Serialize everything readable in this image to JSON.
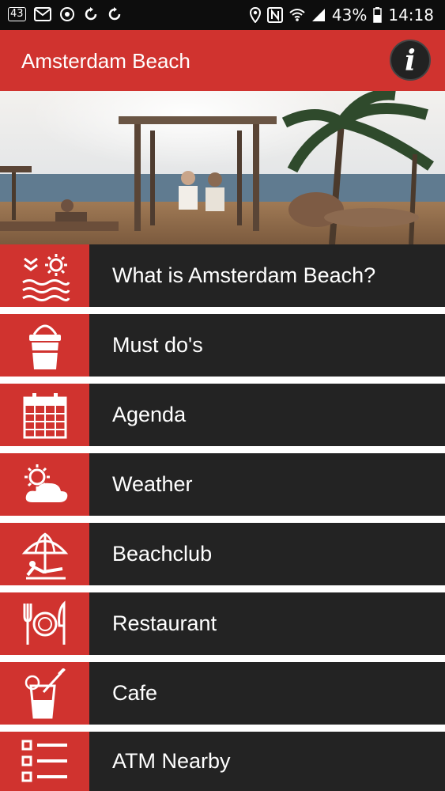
{
  "status_bar": {
    "notification_badge": "43",
    "battery_percent": "43%",
    "time": "14:18"
  },
  "app_bar": {
    "title": "Amsterdam Beach",
    "info_button": "i"
  },
  "menu": {
    "items": [
      {
        "label": "What is Amsterdam Beach?",
        "icon": "beach-sun-waves-icon"
      },
      {
        "label": "Must do's",
        "icon": "bucket-icon"
      },
      {
        "label": "Agenda",
        "icon": "calendar-icon"
      },
      {
        "label": "Weather",
        "icon": "weather-cloud-sun-icon"
      },
      {
        "label": "Beachclub",
        "icon": "beach-umbrella-icon"
      },
      {
        "label": "Restaurant",
        "icon": "fork-plate-knife-icon"
      },
      {
        "label": "Cafe",
        "icon": "cocktail-icon"
      },
      {
        "label": "ATM Nearby",
        "icon": "list-icon"
      }
    ]
  },
  "colors": {
    "accent_red": "#d0332f",
    "row_dark": "#232323",
    "status_bar": "#0d0d0d"
  }
}
